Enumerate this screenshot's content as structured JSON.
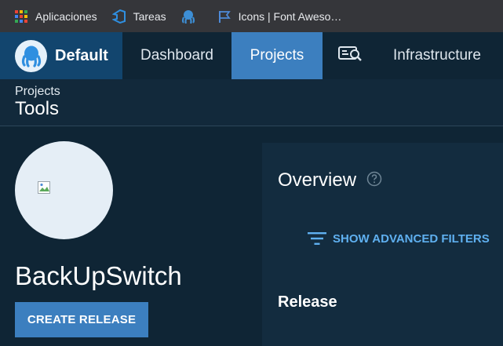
{
  "bookmarks": {
    "items": [
      {
        "label": "Aplicaciones",
        "icon": "apps-grid-icon"
      },
      {
        "label": "Tareas",
        "icon": "azure-devops-icon"
      },
      {
        "label": "",
        "icon": "octopus-icon"
      },
      {
        "label": "Icons | Font Aweso…",
        "icon": "font-awesome-flag-icon"
      }
    ]
  },
  "nav": {
    "brand": "Default",
    "dashboard": "Dashboard",
    "projects": "Projects",
    "tasks_icon": "task-search-icon",
    "infrastructure": "Infrastructure"
  },
  "breadcrumb": {
    "parent": "Projects",
    "current": "Tools"
  },
  "project": {
    "name": "BackUpSwitch",
    "create_release": "CREATE RELEASE"
  },
  "overview": {
    "title": "Overview",
    "filters": "SHOW ADVANCED FILTERS",
    "release_heading": "Release"
  },
  "colors": {
    "background": "#0f2535",
    "brand": "#12456e",
    "active_nav": "#3c7fbf",
    "link": "#5fb0f0"
  }
}
